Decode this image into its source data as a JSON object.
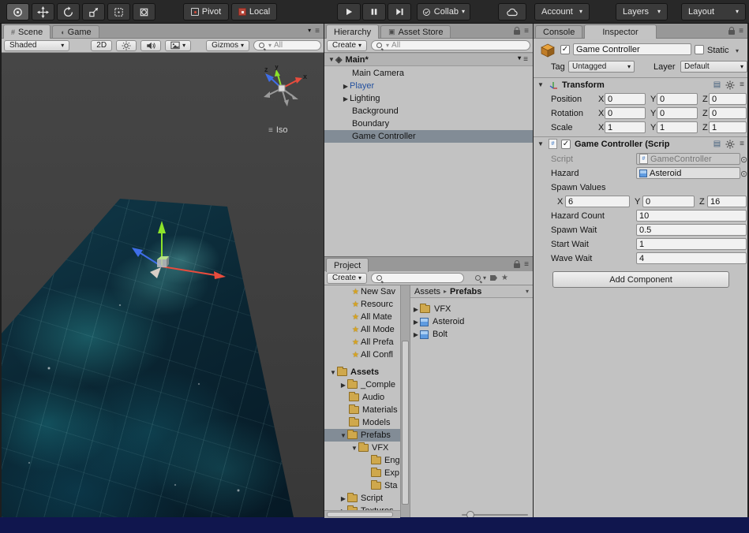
{
  "icons": {
    "dd": "▾",
    "open_tri": "▼",
    "closed_tri": "▶",
    "crumb_sep": "▸",
    "star": "★",
    "menu": "≡",
    "picker": "⊙",
    "scene_glyph": "◈",
    "hash": "#",
    "game_glyph": "◖",
    "store_glyph": "▣",
    "book": "▤",
    "iso_glyph": "≡"
  },
  "topbar": {
    "pivot_label": "Pivot",
    "local_label": "Local",
    "collab_label": "Collab",
    "account_label": "Account",
    "layers_label": "Layers",
    "layout_label": "Layout"
  },
  "scene_panel": {
    "tab_scene": "Scene",
    "tab_game": "Game",
    "shaded_label": "Shaded",
    "mode_2d_label": "2D",
    "gizmos_label": "Gizmos",
    "search_value": "All",
    "iso_label": "Iso",
    "axis": {
      "x": "x",
      "y": "y",
      "z": "z"
    }
  },
  "hierarchy": {
    "tab_hierarchy": "Hierarchy",
    "tab_asset_store": "Asset Store",
    "create_label": "Create",
    "search_value": "All",
    "scene_name": "Main*",
    "items": [
      {
        "label": "Main Camera"
      },
      {
        "label": "Player"
      },
      {
        "label": "Lighting"
      },
      {
        "label": "Background"
      },
      {
        "label": "Boundary"
      },
      {
        "label": "Game Controller"
      }
    ]
  },
  "project": {
    "tab_label": "Project",
    "create_label": "Create",
    "favorites": [
      {
        "label": "New Sav"
      },
      {
        "label": "Resourc"
      },
      {
        "label": "All Mate"
      },
      {
        "label": "All Mode"
      },
      {
        "label": "All Prefa"
      },
      {
        "label": "All Confl"
      }
    ],
    "assets_label": "Assets",
    "tree": [
      {
        "label": "_Comple"
      },
      {
        "label": "Audio"
      },
      {
        "label": "Materials"
      },
      {
        "label": "Models"
      },
      {
        "label": "Prefabs"
      },
      {
        "label": "VFX"
      },
      {
        "label": "Eng"
      },
      {
        "label": "Exp"
      },
      {
        "label": "Sta"
      },
      {
        "label": "Script"
      },
      {
        "label": "Textures"
      }
    ],
    "breadcrumb_root": "Assets",
    "breadcrumb_current": "Prefabs",
    "items": [
      {
        "label": "VFX"
      },
      {
        "label": "Asteroid"
      },
      {
        "label": "Bolt"
      }
    ]
  },
  "inspector": {
    "tab_console": "Console",
    "tab_inspector": "Inspector",
    "object_name": "Game Controller",
    "static_label": "Static",
    "tag_label": "Tag",
    "tag_value": "Untagged",
    "layer_label": "Layer",
    "layer_value": "Default",
    "transform": {
      "title": "Transform",
      "x": "X",
      "y": "Y",
      "z": "Z",
      "rows": [
        {
          "label": "Position",
          "x": "0",
          "y": "0",
          "z": "0"
        },
        {
          "label": "Rotation",
          "x": "0",
          "y": "0",
          "z": "0"
        },
        {
          "label": "Scale",
          "x": "1",
          "y": "1",
          "z": "1"
        }
      ]
    },
    "script_component": {
      "title": "Game Controller (Scrip",
      "script_label": "Script",
      "script_value": "GameController",
      "hazard_label": "Hazard",
      "hazard_value": "Asteroid",
      "spawn_values_label": "Spawn Values",
      "x_label": "X",
      "x_value": "6",
      "y_label": "Y",
      "y_value": "0",
      "z_label": "Z",
      "z_value": "16",
      "props": [
        {
          "label": "Hazard Count",
          "value": "10"
        },
        {
          "label": "Spawn Wait",
          "value": "0.5"
        },
        {
          "label": "Start Wait",
          "value": "1"
        },
        {
          "label": "Wave Wait",
          "value": "4"
        }
      ]
    },
    "add_component_label": "Add Component"
  }
}
